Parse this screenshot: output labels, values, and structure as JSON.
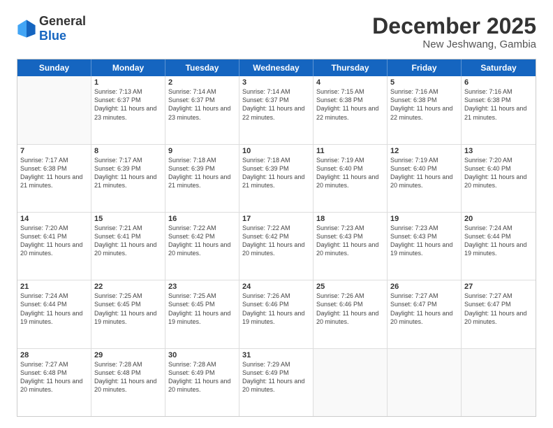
{
  "logo": {
    "general": "General",
    "blue": "Blue"
  },
  "title": {
    "month_year": "December 2025",
    "location": "New Jeshwang, Gambia"
  },
  "weekdays": [
    "Sunday",
    "Monday",
    "Tuesday",
    "Wednesday",
    "Thursday",
    "Friday",
    "Saturday"
  ],
  "weeks": [
    [
      {
        "day": "",
        "sunrise": "",
        "sunset": "",
        "daylight": "",
        "empty": true
      },
      {
        "day": "1",
        "sunrise": "Sunrise: 7:13 AM",
        "sunset": "Sunset: 6:37 PM",
        "daylight": "Daylight: 11 hours and 23 minutes."
      },
      {
        "day": "2",
        "sunrise": "Sunrise: 7:14 AM",
        "sunset": "Sunset: 6:37 PM",
        "daylight": "Daylight: 11 hours and 23 minutes."
      },
      {
        "day": "3",
        "sunrise": "Sunrise: 7:14 AM",
        "sunset": "Sunset: 6:37 PM",
        "daylight": "Daylight: 11 hours and 22 minutes."
      },
      {
        "day": "4",
        "sunrise": "Sunrise: 7:15 AM",
        "sunset": "Sunset: 6:38 PM",
        "daylight": "Daylight: 11 hours and 22 minutes."
      },
      {
        "day": "5",
        "sunrise": "Sunrise: 7:16 AM",
        "sunset": "Sunset: 6:38 PM",
        "daylight": "Daylight: 11 hours and 22 minutes."
      },
      {
        "day": "6",
        "sunrise": "Sunrise: 7:16 AM",
        "sunset": "Sunset: 6:38 PM",
        "daylight": "Daylight: 11 hours and 21 minutes."
      }
    ],
    [
      {
        "day": "7",
        "sunrise": "Sunrise: 7:17 AM",
        "sunset": "Sunset: 6:38 PM",
        "daylight": "Daylight: 11 hours and 21 minutes."
      },
      {
        "day": "8",
        "sunrise": "Sunrise: 7:17 AM",
        "sunset": "Sunset: 6:39 PM",
        "daylight": "Daylight: 11 hours and 21 minutes."
      },
      {
        "day": "9",
        "sunrise": "Sunrise: 7:18 AM",
        "sunset": "Sunset: 6:39 PM",
        "daylight": "Daylight: 11 hours and 21 minutes."
      },
      {
        "day": "10",
        "sunrise": "Sunrise: 7:18 AM",
        "sunset": "Sunset: 6:39 PM",
        "daylight": "Daylight: 11 hours and 21 minutes."
      },
      {
        "day": "11",
        "sunrise": "Sunrise: 7:19 AM",
        "sunset": "Sunset: 6:40 PM",
        "daylight": "Daylight: 11 hours and 20 minutes."
      },
      {
        "day": "12",
        "sunrise": "Sunrise: 7:19 AM",
        "sunset": "Sunset: 6:40 PM",
        "daylight": "Daylight: 11 hours and 20 minutes."
      },
      {
        "day": "13",
        "sunrise": "Sunrise: 7:20 AM",
        "sunset": "Sunset: 6:40 PM",
        "daylight": "Daylight: 11 hours and 20 minutes."
      }
    ],
    [
      {
        "day": "14",
        "sunrise": "Sunrise: 7:20 AM",
        "sunset": "Sunset: 6:41 PM",
        "daylight": "Daylight: 11 hours and 20 minutes."
      },
      {
        "day": "15",
        "sunrise": "Sunrise: 7:21 AM",
        "sunset": "Sunset: 6:41 PM",
        "daylight": "Daylight: 11 hours and 20 minutes."
      },
      {
        "day": "16",
        "sunrise": "Sunrise: 7:22 AM",
        "sunset": "Sunset: 6:42 PM",
        "daylight": "Daylight: 11 hours and 20 minutes."
      },
      {
        "day": "17",
        "sunrise": "Sunrise: 7:22 AM",
        "sunset": "Sunset: 6:42 PM",
        "daylight": "Daylight: 11 hours and 20 minutes."
      },
      {
        "day": "18",
        "sunrise": "Sunrise: 7:23 AM",
        "sunset": "Sunset: 6:43 PM",
        "daylight": "Daylight: 11 hours and 20 minutes."
      },
      {
        "day": "19",
        "sunrise": "Sunrise: 7:23 AM",
        "sunset": "Sunset: 6:43 PM",
        "daylight": "Daylight: 11 hours and 19 minutes."
      },
      {
        "day": "20",
        "sunrise": "Sunrise: 7:24 AM",
        "sunset": "Sunset: 6:44 PM",
        "daylight": "Daylight: 11 hours and 19 minutes."
      }
    ],
    [
      {
        "day": "21",
        "sunrise": "Sunrise: 7:24 AM",
        "sunset": "Sunset: 6:44 PM",
        "daylight": "Daylight: 11 hours and 19 minutes."
      },
      {
        "day": "22",
        "sunrise": "Sunrise: 7:25 AM",
        "sunset": "Sunset: 6:45 PM",
        "daylight": "Daylight: 11 hours and 19 minutes."
      },
      {
        "day": "23",
        "sunrise": "Sunrise: 7:25 AM",
        "sunset": "Sunset: 6:45 PM",
        "daylight": "Daylight: 11 hours and 19 minutes."
      },
      {
        "day": "24",
        "sunrise": "Sunrise: 7:26 AM",
        "sunset": "Sunset: 6:46 PM",
        "daylight": "Daylight: 11 hours and 19 minutes."
      },
      {
        "day": "25",
        "sunrise": "Sunrise: 7:26 AM",
        "sunset": "Sunset: 6:46 PM",
        "daylight": "Daylight: 11 hours and 20 minutes."
      },
      {
        "day": "26",
        "sunrise": "Sunrise: 7:27 AM",
        "sunset": "Sunset: 6:47 PM",
        "daylight": "Daylight: 11 hours and 20 minutes."
      },
      {
        "day": "27",
        "sunrise": "Sunrise: 7:27 AM",
        "sunset": "Sunset: 6:47 PM",
        "daylight": "Daylight: 11 hours and 20 minutes."
      }
    ],
    [
      {
        "day": "28",
        "sunrise": "Sunrise: 7:27 AM",
        "sunset": "Sunset: 6:48 PM",
        "daylight": "Daylight: 11 hours and 20 minutes."
      },
      {
        "day": "29",
        "sunrise": "Sunrise: 7:28 AM",
        "sunset": "Sunset: 6:48 PM",
        "daylight": "Daylight: 11 hours and 20 minutes."
      },
      {
        "day": "30",
        "sunrise": "Sunrise: 7:28 AM",
        "sunset": "Sunset: 6:49 PM",
        "daylight": "Daylight: 11 hours and 20 minutes."
      },
      {
        "day": "31",
        "sunrise": "Sunrise: 7:29 AM",
        "sunset": "Sunset: 6:49 PM",
        "daylight": "Daylight: 11 hours and 20 minutes."
      },
      {
        "day": "",
        "sunrise": "",
        "sunset": "",
        "daylight": "",
        "empty": true
      },
      {
        "day": "",
        "sunrise": "",
        "sunset": "",
        "daylight": "",
        "empty": true
      },
      {
        "day": "",
        "sunrise": "",
        "sunset": "",
        "daylight": "",
        "empty": true
      }
    ]
  ]
}
